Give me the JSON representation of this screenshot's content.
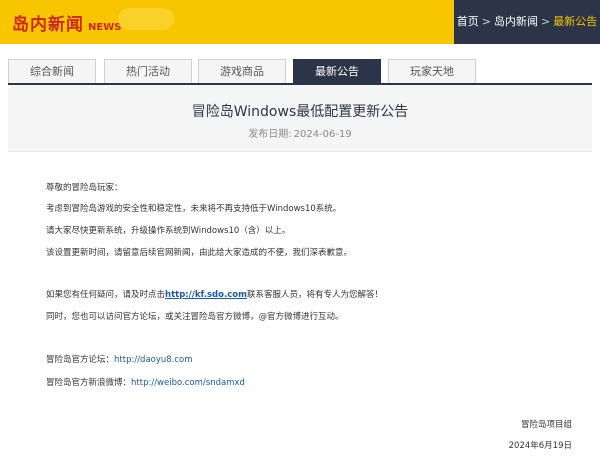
{
  "header": {
    "logo_cn": "岛内新闻",
    "logo_en": "NEWS",
    "breadcrumb": [
      "首页",
      "岛内新闻",
      "最新公告"
    ],
    "separator": ">"
  },
  "tabs": [
    {
      "label": "综合新闻",
      "active": false
    },
    {
      "label": "热门活动",
      "active": false
    },
    {
      "label": "游戏商品",
      "active": false
    },
    {
      "label": "最新公告",
      "active": true
    },
    {
      "label": "玩家天地",
      "active": false
    }
  ],
  "article": {
    "title": "冒险岛Windows最低配置更新公告",
    "date_label": "发布日期:",
    "date": "2024-06-19",
    "greeting": "尊敬的冒险岛玩家：",
    "p1": "考虑到冒险岛游戏的安全性和稳定性，未来将不再支持低于Windows10系统。",
    "p2": "请大家尽快更新系统，升级操作系统到Windows10（含）以上。",
    "p3": "该设置更新时间，请留意后续官网新闻，由此给大家造成的不便，我们深表歉意。",
    "contact_before": "如果您有任何疑问，请及时点击",
    "contact_link": "http://kf.sdo.com",
    "contact_after": "联系客服人员，将有专人为您解答！",
    "p_forum": "同时，您也可以访问官方论坛，或关注冒险岛官方微博，@官方微博进行互动。",
    "forum_label": "冒险岛官方论坛：",
    "forum_url": "http://daoyu8.com",
    "weibo_label": "冒险岛官方新浪微博：",
    "weibo_url": "http://weibo.com/sndamxd",
    "sign_team": "冒险岛项目组",
    "sign_date": "2024年6月19日"
  },
  "colors": {
    "header_yellow": "#f7c600",
    "dark_navy": "#2b3547",
    "logo_red": "#d0261b",
    "link_blue": "#1a5aa6"
  }
}
